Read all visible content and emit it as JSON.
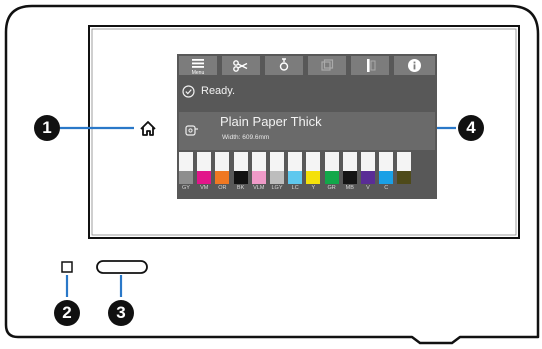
{
  "colors": {
    "frame": "#111111",
    "screen_bg": "#585858",
    "toolbar_button": "#7c7c7c",
    "callout_line": "#2a78c8",
    "badge": "#111111"
  },
  "screen": {
    "toolbar": {
      "menu_label": "Menu",
      "icons": [
        "menu-icon",
        "scissors-icon",
        "maintenance-icon",
        "paper-feed-icon",
        "paper-info-icon",
        "info-icon"
      ]
    },
    "status": {
      "icon": "check-circle-icon",
      "text": "Ready."
    },
    "paper": {
      "icon": "paper-roll-icon",
      "name": "Plain Paper Thick",
      "width_text": "Width: 609.6mm"
    },
    "inks": [
      {
        "label": "GY",
        "level": 0.4,
        "color": "#8e8e8e"
      },
      {
        "label": "VM",
        "level": 0.4,
        "color": "#e2158a"
      },
      {
        "label": "OR",
        "level": 0.4,
        "color": "#f07822"
      },
      {
        "label": "BK",
        "level": 0.4,
        "color": "#111111"
      },
      {
        "label": "VLM",
        "level": 0.4,
        "color": "#f09ac8"
      },
      {
        "label": "LGY",
        "level": 0.4,
        "color": "#bdbdbd"
      },
      {
        "label": "LC",
        "level": 0.4,
        "color": "#5ec8ee"
      },
      {
        "label": "Y",
        "level": 0.4,
        "color": "#f4e10a"
      },
      {
        "label": "GR",
        "level": 0.4,
        "color": "#12a84a"
      },
      {
        "label": "MB",
        "level": 0.4,
        "color": "#141414"
      },
      {
        "label": "V",
        "level": 0.4,
        "color": "#5a2d96"
      },
      {
        "label": "C",
        "level": 0.4,
        "color": "#1aa0e6"
      },
      {
        "label": "",
        "level": 0.4,
        "color": "#4e4a1a"
      }
    ]
  },
  "home_icon": "home-icon",
  "power_light_icon": "power-light-icon",
  "callouts": [
    "1",
    "2",
    "3",
    "4"
  ]
}
